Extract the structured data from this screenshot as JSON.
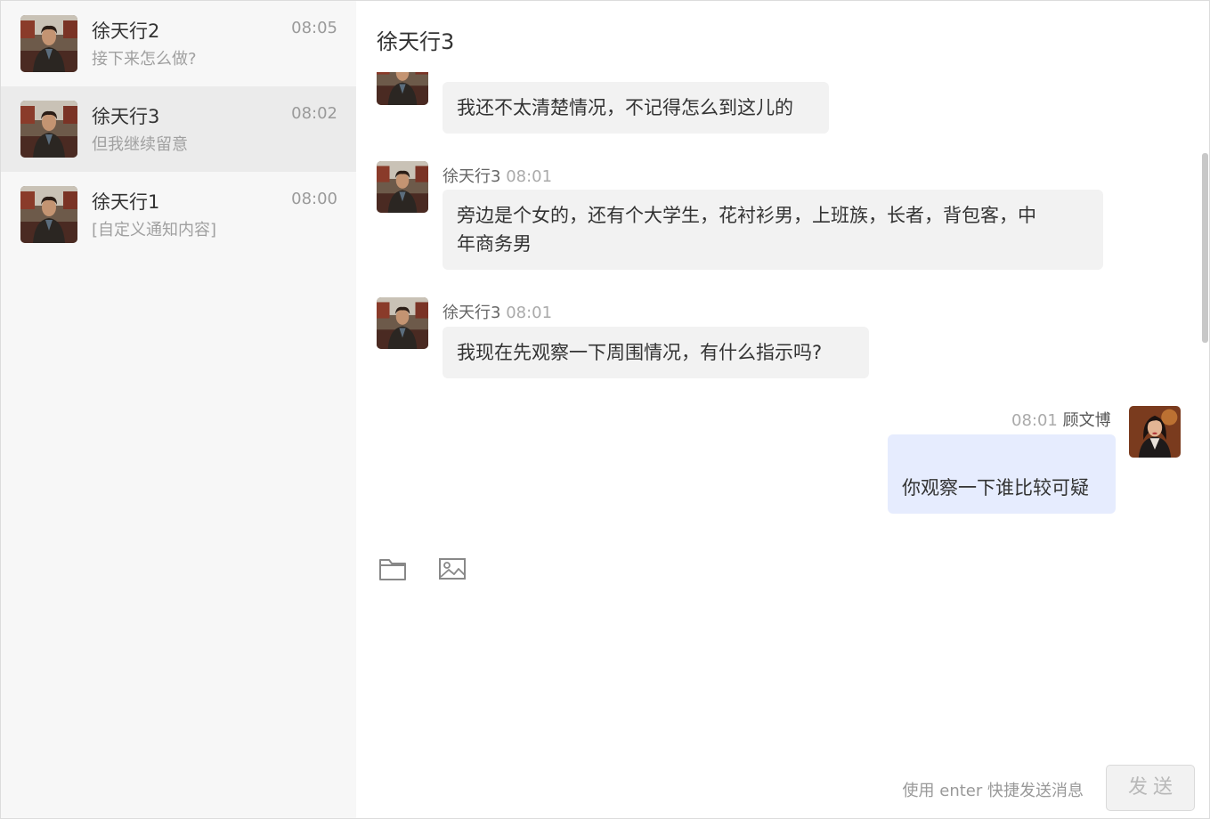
{
  "conversations": [
    {
      "name": "徐天行2",
      "time": "08:05",
      "preview": "接下来怎么做?"
    },
    {
      "name": "徐天行3",
      "time": "08:02",
      "preview": "但我继续留意"
    },
    {
      "name": "徐天行1",
      "time": "08:00",
      "preview": "[自定义通知内容]"
    }
  ],
  "chat": {
    "title": "徐天行3",
    "messages": [
      {
        "text": "我还不太清楚情况，不记得怎么到这儿的"
      },
      {
        "sender": "徐天行3",
        "time": "08:01",
        "text_line1": "旁边是个女的，还有个大学生，花衬衫男，上班族，长者，背包客，中",
        "text_line2": "年商务男"
      },
      {
        "sender": "徐天行3",
        "time": "08:01",
        "text": "我现在先观察一下周围情况，有什么指示吗?"
      },
      {
        "sender": "顾文博",
        "time": "08:01",
        "text": "你观察一下谁比较可疑"
      }
    ]
  },
  "composer": {
    "icons": [
      "folder-icon",
      "image-icon"
    ],
    "hint": "使用 enter 快捷发送消息",
    "send_label": "发送"
  },
  "colors": {
    "sidebar_bg": "#f7f7f7",
    "active_item_bg": "#ebebeb",
    "incoming_bubble": "#f2f2f2",
    "outgoing_bubble": "#e6ecfe"
  }
}
